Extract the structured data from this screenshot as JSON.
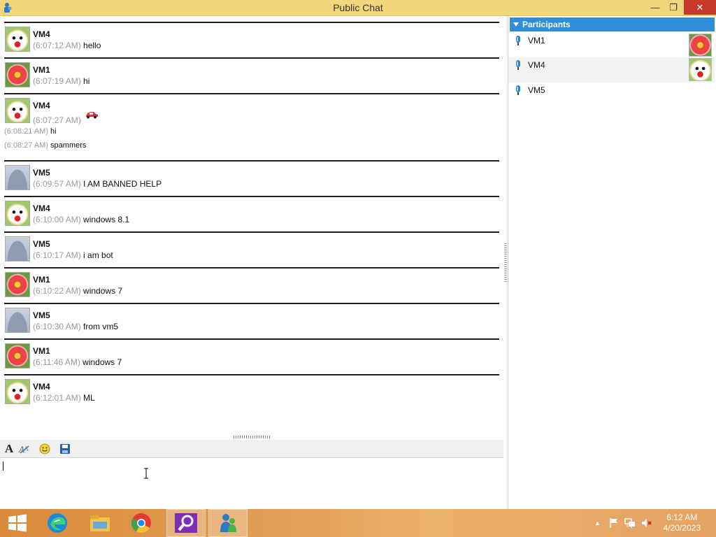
{
  "window": {
    "title": "Public Chat",
    "minimize_glyph": "—",
    "maximize_glyph": "❐",
    "close_glyph": "✕"
  },
  "avatars": {
    "cat": "lucky-cat-avatar",
    "flower": "red-flower-avatar",
    "person": "default-person-avatar"
  },
  "messages": [
    {
      "sender": "VM4",
      "time": "(6:07:12 AM)",
      "text": "hello",
      "avatar": "cat"
    },
    {
      "sender": "VM1",
      "time": "(6:07:19 AM)",
      "text": "hi",
      "avatar": "flower"
    },
    {
      "sender": "VM4",
      "time": "(6:07:27 AM)",
      "text": "",
      "avatar": "cat",
      "emoji": "car-emoticon",
      "extra": [
        {
          "time": "(6:08:21 AM)",
          "text": "hi"
        },
        {
          "time": "(6:08:27 AM)",
          "text": "spammers"
        }
      ]
    },
    {
      "sender": "VM5",
      "time": "(6:09:57 AM)",
      "text": "I AM BANNED HELP",
      "avatar": "person"
    },
    {
      "sender": "VM4",
      "time": "(6:10:00 AM)",
      "text": "windows 8.1",
      "avatar": "cat"
    },
    {
      "sender": "VM5",
      "time": "(6:10:17 AM)",
      "text": "i am bot",
      "avatar": "person"
    },
    {
      "sender": "VM1",
      "time": "(6:10:22 AM)",
      "text": "windows 7",
      "avatar": "flower"
    },
    {
      "sender": "VM5",
      "time": "(6:10:30 AM)",
      "text": "from vm5",
      "avatar": "person"
    },
    {
      "sender": "VM1",
      "time": "(6:11:46 AM)",
      "text": "windows 7",
      "avatar": "flower"
    },
    {
      "sender": "VM4",
      "time": "(6:12:01 AM)",
      "text": "ML",
      "avatar": "cat"
    }
  ],
  "toolbar": {
    "font_glyph": "A",
    "items": [
      "font-icon",
      "font-color-icon",
      "emoticon-icon",
      "save-icon"
    ]
  },
  "participants": {
    "header": "Participants",
    "list": [
      {
        "name": "VM1",
        "avatar": "flower",
        "selected": false
      },
      {
        "name": "VM4",
        "avatar": "cat",
        "selected": true
      },
      {
        "name": "VM5",
        "avatar": "",
        "selected": false
      }
    ]
  },
  "taskbar": {
    "items": [
      "windows-start-icon",
      "edge-icon",
      "file-explorer-icon",
      "chrome-icon",
      "search-app-icon",
      "messenger-app-icon"
    ],
    "clock_time": "6:12 AM",
    "clock_date": "4/20/2023",
    "tray_chevron": "▲"
  },
  "colors": {
    "titlebar": "#f1d67c",
    "close": "#c6392b",
    "participants_header": "#2f8fd9",
    "timestamp": "#9a9a9a"
  }
}
